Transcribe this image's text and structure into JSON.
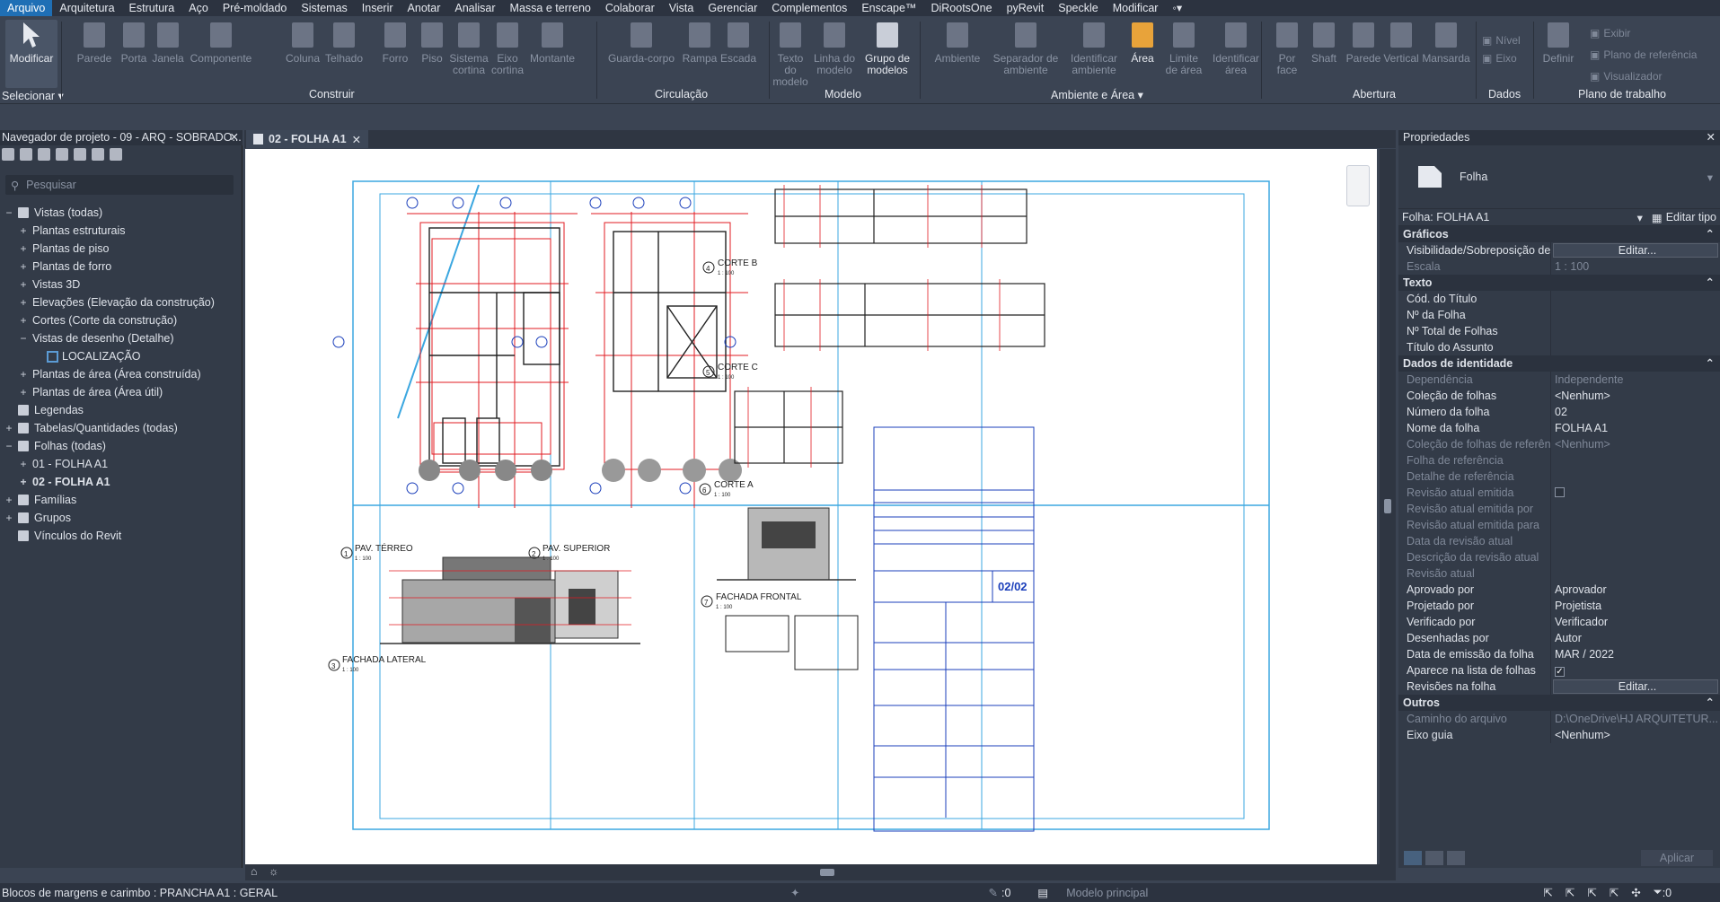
{
  "menu": {
    "items": [
      "Arquivo",
      "Arquitetura",
      "Estrutura",
      "Aço",
      "Pré-moldado",
      "Sistemas",
      "Inserir",
      "Anotar",
      "Analisar",
      "Massa e terreno",
      "Colaborar",
      "Vista",
      "Gerenciar",
      "Complementos",
      "Enscape™",
      "DiRootsOne",
      "pyRevit",
      "Speckle",
      "Modificar"
    ]
  },
  "ribbon": {
    "modify": "Modificar",
    "select": "Selecionar ▾",
    "construir": [
      "Parede",
      "Porta",
      "Janela",
      "Componente",
      "Coluna",
      "Telhado",
      "Forro",
      "Piso",
      "Sistema cortina",
      "Eixo cortina",
      "Montante"
    ],
    "circulacao": [
      "Guarda-corpo",
      "Rampa",
      "Escada"
    ],
    "modelo": [
      "Texto do modelo",
      "Linha do modelo",
      "Grupo de modelos"
    ],
    "ambiente": [
      "Ambiente",
      "Separador de ambiente",
      "Identificar ambiente",
      "Área",
      "Limite de área",
      "Identificar área"
    ],
    "abertura": [
      "Por face",
      "Shaft",
      "Parede",
      "Vertical",
      "Mansarda"
    ],
    "dados": [
      "Nível",
      "Eixo"
    ],
    "trabalho": [
      "Definir",
      "Exibir",
      "Plano de referência",
      "Visualizador"
    ],
    "groups": [
      "Construir",
      "Circulação",
      "Modelo",
      "Ambiente e Área ▾",
      "Abertura",
      "Dados",
      "Plano de trabalho"
    ]
  },
  "browser": {
    "title": "Navegador de projeto - 09 - ARQ - SOBRADO...",
    "search_placeholder": "Pesquisar",
    "tree": [
      {
        "label": "Vistas (todas)",
        "level": 0,
        "exp": "−"
      },
      {
        "label": "Plantas estruturais",
        "level": 1,
        "exp": "+"
      },
      {
        "label": "Plantas de piso",
        "level": 1,
        "exp": "+"
      },
      {
        "label": "Plantas de forro",
        "level": 1,
        "exp": "+"
      },
      {
        "label": "Vistas 3D",
        "level": 1,
        "exp": "+"
      },
      {
        "label": "Elevações (Elevação da construção)",
        "level": 1,
        "exp": "+"
      },
      {
        "label": "Cortes (Corte da construção)",
        "level": 1,
        "exp": "+"
      },
      {
        "label": "Vistas de desenho (Detalhe)",
        "level": 1,
        "exp": "−"
      },
      {
        "label": "LOCALIZAÇÃO",
        "level": 2,
        "exp": ""
      },
      {
        "label": "Plantas de área (Área construída)",
        "level": 1,
        "exp": "+"
      },
      {
        "label": "Plantas de área (Área útil)",
        "level": 1,
        "exp": "+"
      },
      {
        "label": "Legendas",
        "level": 0,
        "exp": ""
      },
      {
        "label": "Tabelas/Quantidades (todas)",
        "level": 0,
        "exp": "+"
      },
      {
        "label": "Folhas (todas)",
        "level": 0,
        "exp": "−"
      },
      {
        "label": "01 - FOLHA A1",
        "level": 1,
        "exp": "+"
      },
      {
        "label": "02 - FOLHA A1",
        "level": 1,
        "exp": "+",
        "bold": true
      },
      {
        "label": "Famílias",
        "level": 0,
        "exp": "+"
      },
      {
        "label": "Grupos",
        "level": 0,
        "exp": "+"
      },
      {
        "label": "Vínculos do Revit",
        "level": 0,
        "exp": ""
      }
    ]
  },
  "view_tab": {
    "label": "02 - FOLHA A1"
  },
  "sheet": {
    "views": [
      {
        "n": "1",
        "name": "PAV. TÉRREO",
        "scale": "1 : 100"
      },
      {
        "n": "2",
        "name": "PAV. SUPERIOR",
        "scale": "1 : 100"
      },
      {
        "n": "3",
        "name": "FACHADA LATERAL",
        "scale": "1 : 100"
      },
      {
        "n": "4",
        "name": "CORTE B",
        "scale": "1 : 100"
      },
      {
        "n": "5",
        "name": "CORTE C",
        "scale": "1 : 100"
      },
      {
        "n": "6",
        "name": "CORTE A",
        "scale": "1 : 100"
      },
      {
        "n": "7",
        "name": "FACHADA FRONTAL",
        "scale": "1 : 100"
      }
    ],
    "sheet_number": "02/02"
  },
  "properties": {
    "title": "Propriedades",
    "type_name": "Folha",
    "selector": "Folha: FOLHA A1",
    "edit_type": "Editar tipo",
    "groups": [
      {
        "name": "Gráficos",
        "rows": [
          {
            "k": "Visibilidade/Sobreposição de...",
            "v": "Editar...",
            "btn": true
          },
          {
            "k": "Escala",
            "v": "1 : 100",
            "dis": true
          }
        ]
      },
      {
        "name": "Texto",
        "rows": [
          {
            "k": "Cód. do Título",
            "v": ""
          },
          {
            "k": "Nº da Folha",
            "v": ""
          },
          {
            "k": "Nº Total de Folhas",
            "v": ""
          },
          {
            "k": "Título do Assunto",
            "v": ""
          }
        ]
      },
      {
        "name": "Dados de identidade",
        "rows": [
          {
            "k": "Dependência",
            "v": "Independente",
            "dis": true
          },
          {
            "k": "Coleção de folhas",
            "v": "<Nenhum>"
          },
          {
            "k": "Número da folha",
            "v": "02"
          },
          {
            "k": "Nome da folha",
            "v": "FOLHA A1"
          },
          {
            "k": "Coleção de folhas de referên...",
            "v": "<Nenhum>",
            "dis": true
          },
          {
            "k": "Folha de referência",
            "v": "",
            "dis": true
          },
          {
            "k": "Detalhe de referência",
            "v": "",
            "dis": true
          },
          {
            "k": "Revisão atual emitida",
            "v": "",
            "dis": true,
            "chk": "empty"
          },
          {
            "k": "Revisão atual emitida por",
            "v": "",
            "dis": true
          },
          {
            "k": "Revisão atual emitida para",
            "v": "",
            "dis": true
          },
          {
            "k": "Data da revisão atual",
            "v": "",
            "dis": true
          },
          {
            "k": "Descrição da revisão atual",
            "v": "",
            "dis": true
          },
          {
            "k": "Revisão atual",
            "v": "",
            "dis": true
          },
          {
            "k": "Aprovado por",
            "v": "Aprovador"
          },
          {
            "k": "Projetado por",
            "v": "Projetista"
          },
          {
            "k": "Verificado por",
            "v": "Verificador"
          },
          {
            "k": "Desenhadas por",
            "v": "Autor"
          },
          {
            "k": "Data de emissão da folha",
            "v": "MAR / 2022"
          },
          {
            "k": "Aparece na lista de folhas",
            "v": "",
            "chk": "checked"
          },
          {
            "k": "Revisões na folha",
            "v": "Editar...",
            "btn": true
          }
        ]
      },
      {
        "name": "Outros",
        "rows": [
          {
            "k": "Caminho do arquivo",
            "v": "D:\\OneDrive\\HJ ARQUITETUR...",
            "dis": true
          },
          {
            "k": "Eixo guia",
            "v": "<Nenhum>"
          }
        ]
      }
    ],
    "apply": "Aplicar"
  },
  "status": {
    "text": "Blocos de margens e carimbo : PRANCHA A1 : GERAL",
    "zero1": ":0",
    "model": "Modelo principal",
    "zero2": ":0"
  }
}
